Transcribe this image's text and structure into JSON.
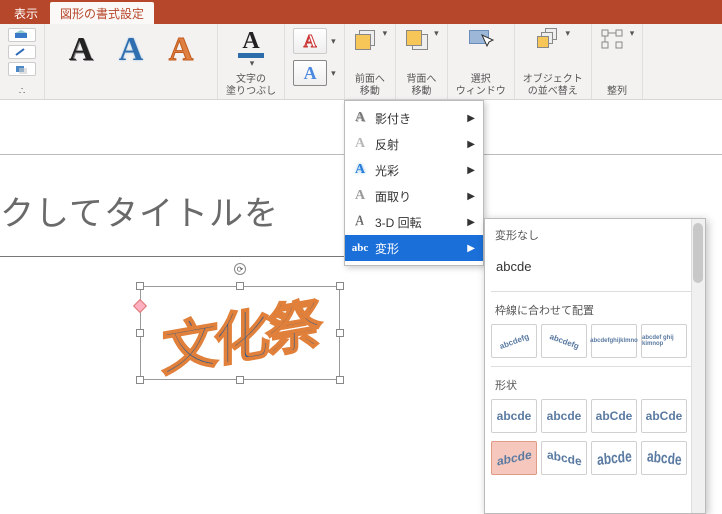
{
  "tabs": {
    "view": "表示",
    "format": "図形の書式設定"
  },
  "ribbon": {
    "fill_label": "∴",
    "wordart_styles": "A",
    "text_fill": {
      "label": "文字の\n塗りつぶし"
    },
    "outline_a": "A",
    "effects_btn": "A",
    "bring_forward": "前面へ\n移動",
    "send_backward": "背面へ\n移動",
    "selection_pane": "選択\nウィンドウ",
    "align": "オブジェクト\nの並べ替え",
    "arrange": "整列",
    "dropdown_glyph": "▾"
  },
  "menu": {
    "items": [
      {
        "icon": "A",
        "label": "影付き",
        "color": "#7a7a7a"
      },
      {
        "icon": "A",
        "label": "反射",
        "color": "#a7a7a7"
      },
      {
        "icon": "A",
        "label": "光彩",
        "color": "#2a7ddc"
      },
      {
        "icon": "A",
        "label": "面取り",
        "color": "#9a9a9a"
      },
      {
        "icon": "A",
        "label": "3-D 回転",
        "color": "#6a6a6a"
      },
      {
        "icon": "⟶",
        "label": "変形",
        "color": "#fff",
        "highlight": true
      }
    ],
    "arrow": "▶"
  },
  "submenu": {
    "cat_none": "変形なし",
    "sample_none": "abcde",
    "cat_follow_path": "枠線に合わせて配置",
    "path_samples": [
      "abcdefg",
      "abcdefg",
      "abcdefghijklmno",
      "abcdef ghij kimnop"
    ],
    "cat_warp": "形状",
    "warp_samples_row1": [
      "abcde",
      "abcde",
      "abCde",
      "abCde"
    ],
    "warp_samples_row2": [
      "abcde",
      "abcde",
      "abcde",
      "abcde"
    ],
    "selected_index": 0
  },
  "canvas": {
    "title_placeholder": "クしてタイトルを",
    "wordart_text": "文化祭",
    "rotate_glyph": "⟳"
  }
}
